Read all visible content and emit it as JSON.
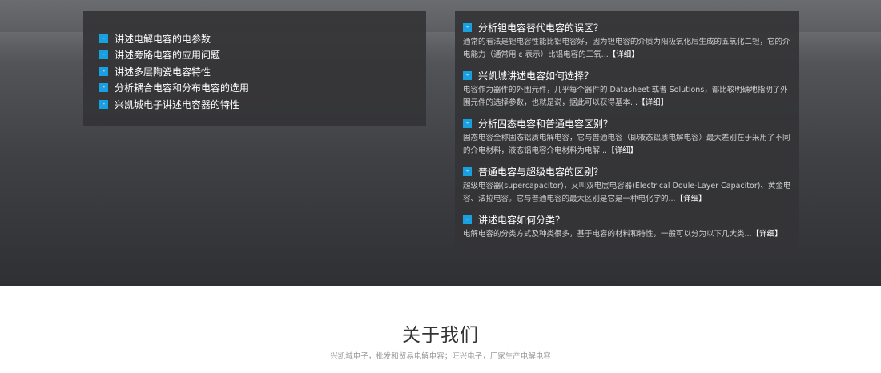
{
  "left_panel": {
    "items": [
      "讲述电解电容的电参数",
      "讲述旁路电容的应用问题",
      "讲述多层陶瓷电容特性",
      "分析耦合电容和分布电容的选用",
      "兴凯城电子讲述电容器的特性"
    ]
  },
  "right_panel": {
    "articles": [
      {
        "title": "分析钽电容替代电容的误区？",
        "desc": "通常的看法是钽电容性能比铝电容好，因为钽电容的介质为阳极氧化后生成的五氧化二钽，它的介电能力（通常用 ε 表示）比铝电容的三氧...",
        "more": "【详细】"
      },
      {
        "title": "兴凯城讲述电容如何选择？",
        "desc": "电容作为器件的外围元件，几乎每个器件的 Datasheet 或者 Solutions，都比较明确地指明了外围元件的选择参数，也就是说，据此可以获得基本...",
        "more": "【详细】"
      },
      {
        "title": "分析固态电容和普通电容区别？",
        "desc": "固态电容全称固态铝质电解电容，它与普通电容（即液态铝质电解电容）最大差别在于采用了不同的介电材料，液态铝电容介电材料为电解...",
        "more": "【详细】"
      },
      {
        "title": "普通电容与超级电容的区别？",
        "desc": "超级电容器(supercapacitor)，又叫双电层电容器(Electrical Doule-Layer Capacitor)、黄金电容、法拉电容。它与普通电容的最大区别是它是一种电化学的...",
        "more": "【详细】"
      },
      {
        "title": "讲述电容如何分类？",
        "desc": "电解电容的分类方式及种类很多，基于电容的材料和特性，一般可以分为以下几大类...",
        "more": "【详细】"
      }
    ]
  },
  "about": {
    "title": "关于我们",
    "subtitle": "兴凯城电子，批发和贸易电解电容；旺兴电子，厂家生产电解电容"
  },
  "bullet_glyph": "-",
  "colors": {
    "accent": "#19a0e0",
    "panel": "#343436"
  }
}
